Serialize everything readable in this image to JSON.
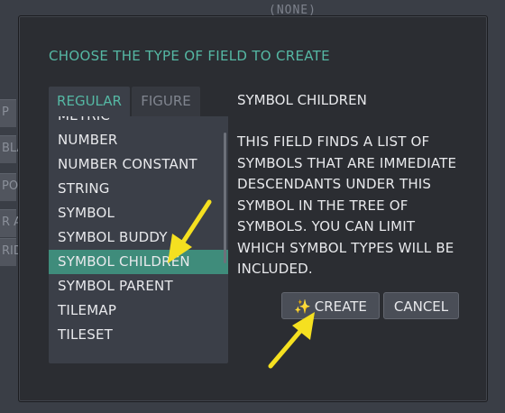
{
  "background": {
    "top_text": "(NONE)",
    "left_labels": [
      "P",
      "BLA",
      "PO",
      "R A",
      "RID"
    ]
  },
  "dialog": {
    "title": "CHOOSE THE TYPE OF FIELD TO CREATE",
    "tabs": [
      {
        "label": "REGULAR",
        "active": true
      },
      {
        "label": "FIGURE",
        "active": false
      }
    ],
    "field_types": [
      "METRIC",
      "NUMBER",
      "NUMBER CONSTANT",
      "STRING",
      "SYMBOL",
      "SYMBOL BUDDY",
      "SYMBOL CHILDREN",
      "SYMBOL PARENT",
      "TILEMAP",
      "TILESET"
    ],
    "selected_field_type": "SYMBOL CHILDREN",
    "description": {
      "title": "SYMBOL CHILDREN",
      "lines": [
        "THIS FIELD FINDS A LIST OF",
        "SYMBOLS THAT ARE IMMEDIATE",
        "DESCENDANTS UNDER THIS",
        "SYMBOL IN THE TREE OF",
        "SYMBOLS. YOU CAN LIMIT",
        "WHICH SYMBOL TYPES WILL BE",
        "INCLUDED."
      ]
    },
    "buttons": {
      "create_icon": "sparkle-icon",
      "create_label": "CREATE",
      "cancel_label": "CANCEL"
    }
  },
  "annotations": {
    "arrow_color": "#f5e020",
    "accent_color": "#55b8a4",
    "selected_row_color": "#3f8c7b"
  }
}
